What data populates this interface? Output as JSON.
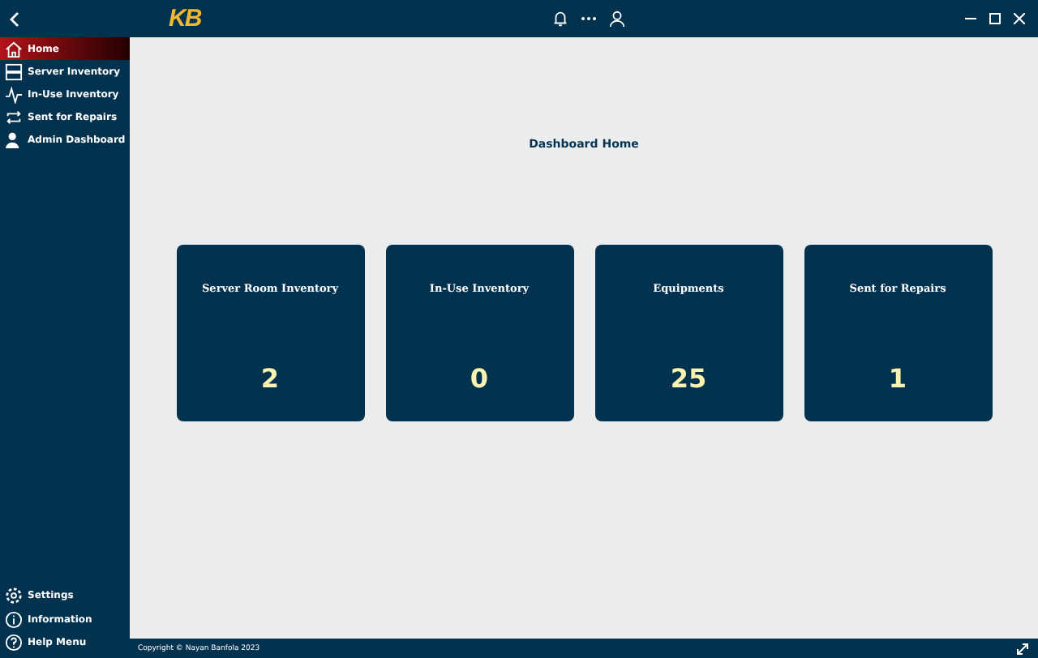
{
  "header": {
    "logo": "KB"
  },
  "sidebar": {
    "items": [
      {
        "label": "Home",
        "selected": true
      },
      {
        "label": "Server Inventory",
        "selected": false
      },
      {
        "label": "In-Use Inventory",
        "selected": false
      },
      {
        "label": "Sent for Repairs",
        "selected": false
      },
      {
        "label": "Admin Dashboard",
        "selected": false
      }
    ],
    "bottom_items": [
      {
        "label": "Settings"
      },
      {
        "label": "Information"
      },
      {
        "label": "Help Menu"
      }
    ]
  },
  "main": {
    "title": "Dashboard Home",
    "cards": [
      {
        "title": "Server Room Inventory",
        "count": "2"
      },
      {
        "title": "In-Use Inventory",
        "count": "0"
      },
      {
        "title": "Equipments",
        "count": "25"
      },
      {
        "title": "Sent for Repairs",
        "count": "1"
      }
    ]
  },
  "footer": {
    "copyright": "Copyright © Nayan Banfola 2023"
  }
}
